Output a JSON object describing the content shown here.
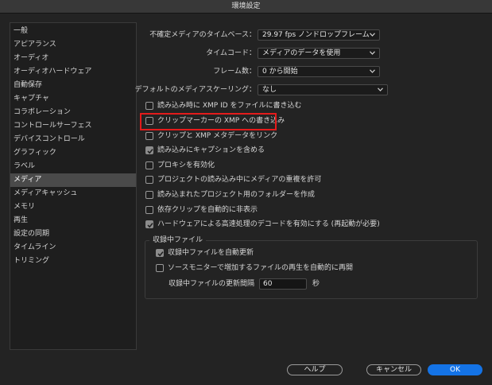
{
  "window": {
    "title": "環境設定"
  },
  "sidebar": {
    "items": [
      "一般",
      "アピアランス",
      "オーディオ",
      "オーディオハードウェア",
      "自動保存",
      "キャプチャ",
      "コラボレーション",
      "コントロールサーフェス",
      "デバイスコントロール",
      "グラフィック",
      "ラベル",
      "メディア",
      "メディアキャッシュ",
      "メモリ",
      "再生",
      "設定の同期",
      "タイムライン",
      "トリミング"
    ],
    "selected_index": 11
  },
  "settings": {
    "timebase": {
      "label": "不確定メディアのタイムベース：",
      "value": "29.97 fps ノンドロップフレーム"
    },
    "timecode": {
      "label": "タイムコード：",
      "value": "メディアのデータを使用"
    },
    "frame_count": {
      "label": "フレーム数：",
      "value": "0 から開始"
    },
    "scaling": {
      "label": "デフォルトのメディアスケーリング：",
      "value": "なし"
    }
  },
  "checkboxes": [
    {
      "label": "読み込み時に XMP ID をファイルに書き込む",
      "checked": false
    },
    {
      "label": "クリップマーカーの XMP への書き込み",
      "checked": false
    },
    {
      "label": "クリップと XMP メタデータをリンク",
      "checked": false
    },
    {
      "label": "読み込みにキャプションを含める",
      "checked": true
    },
    {
      "label": "プロキシを有効化",
      "checked": false
    },
    {
      "label": "プロジェクトの読み込み中にメディアの重複を許可",
      "checked": false
    },
    {
      "label": "読み込まれたプロジェクト用のフォルダーを作成",
      "checked": false
    },
    {
      "label": "依存クリップを自動的に非表示",
      "checked": false
    },
    {
      "label": "ハードウェアによる高速処理のデコードを有効にする (再起動が必要)",
      "checked": true
    }
  ],
  "ingest_group": {
    "title": "収録中ファイル",
    "auto_refresh": {
      "label": "収録中ファイルを自動更新",
      "checked": true
    },
    "auto_play": {
      "label": "ソースモニターで増加するファイルの再生を自動的に再開",
      "checked": false
    },
    "interval": {
      "label": "収録中ファイルの更新間隔",
      "value": "60",
      "unit": "秒"
    }
  },
  "buttons": {
    "help": "ヘルプ",
    "cancel": "キャンセル",
    "ok": "OK"
  },
  "colors": {
    "accent": "#1473e6",
    "highlight": "#e31b1b"
  }
}
